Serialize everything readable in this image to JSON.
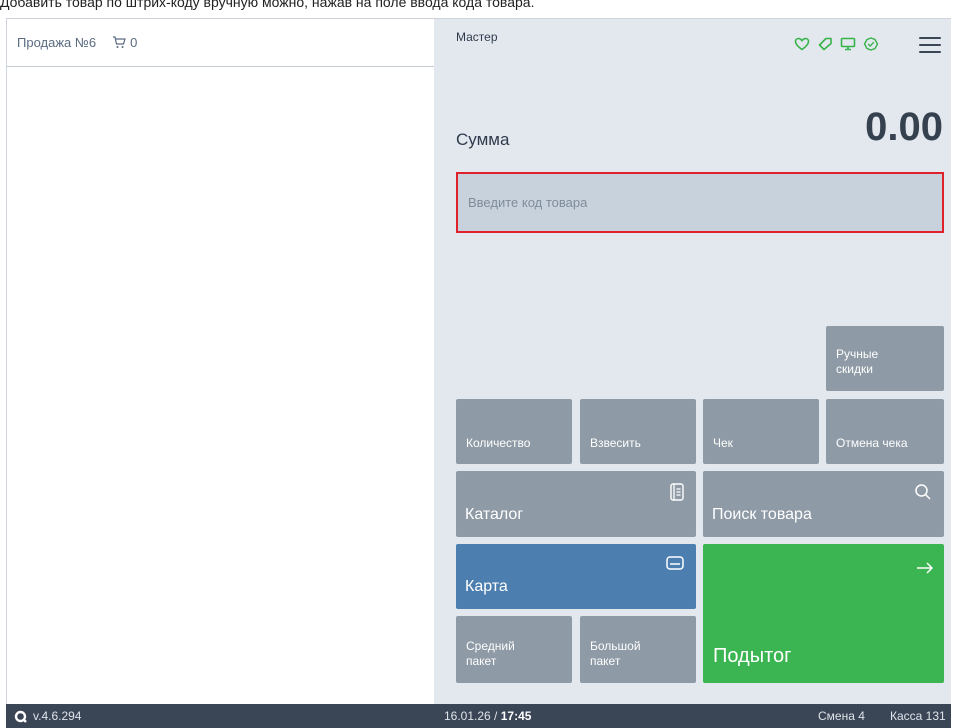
{
  "caption": "Добавить товар по штрих-коду вручную можно, нажав на поле ввода кода товара.",
  "left": {
    "sale_title": "Продажа №6",
    "cart_count": "0"
  },
  "header": {
    "user": "Мастер",
    "icons": [
      "heart-icon",
      "tag-icon",
      "monitor-icon",
      "check-badge-icon",
      "menu-icon"
    ],
    "accent_color": "#37b34a"
  },
  "sum": {
    "label": "Сумма",
    "value": "0.00"
  },
  "code_input": {
    "placeholder": "Введите код товара",
    "value": ""
  },
  "buttons": {
    "manual_discounts": "Ручные скидки",
    "quantity": "Количество",
    "weigh": "Взвесить",
    "receipt": "Чек",
    "cancel_receipt": "Отмена чека",
    "catalog": "Каталог",
    "search_product": "Поиск товара",
    "card": "Карта",
    "medium_bag": "Средний пакет",
    "large_bag": "Большой пакет",
    "subtotal": "Подытог"
  },
  "colors": {
    "button_gray": "#8e9aa5",
    "card_blue": "#4c7fb0",
    "subtotal_green": "#3ab552",
    "input_highlight": "#e0202a"
  },
  "status": {
    "version": "v.4.6.294",
    "date": "16.01.26 /",
    "time": "17:45",
    "shift": "Смена 4",
    "kassa": "Касса 131"
  }
}
